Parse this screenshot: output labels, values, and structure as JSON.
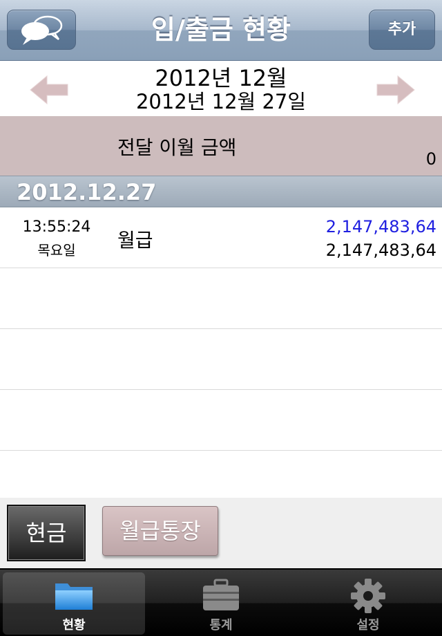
{
  "navbar": {
    "title": "입/출금 현황",
    "add_label": "추가",
    "left_icon": "chat-bubbles-icon"
  },
  "month_header": {
    "month": "2012년 12월",
    "date": "2012년 12월 27일",
    "prev_icon": "arrow-left-icon",
    "next_icon": "arrow-right-icon"
  },
  "carryover": {
    "label": "전달 이월 금액",
    "value": "0"
  },
  "section": {
    "title": "2012.12.27"
  },
  "transactions": [
    {
      "time": "13:55:24",
      "day": "목요일",
      "description": "월급",
      "amount": "2,147,483,64",
      "balance": "2,147,483,64"
    }
  ],
  "accounts": {
    "cash_label": "현금",
    "salary_label": "월급통장"
  },
  "tabs": [
    {
      "label": "현황",
      "icon": "folder-icon",
      "selected": true
    },
    {
      "label": "통계",
      "icon": "briefcase-icon",
      "selected": false
    },
    {
      "label": "설정",
      "icon": "gear-icon",
      "selected": false
    }
  ],
  "colors": {
    "navbar": "#91a6bd",
    "carryover_bg": "#cdbcbd",
    "income_amount": "#1f1fe0",
    "arrow": "#d6bdbf"
  }
}
